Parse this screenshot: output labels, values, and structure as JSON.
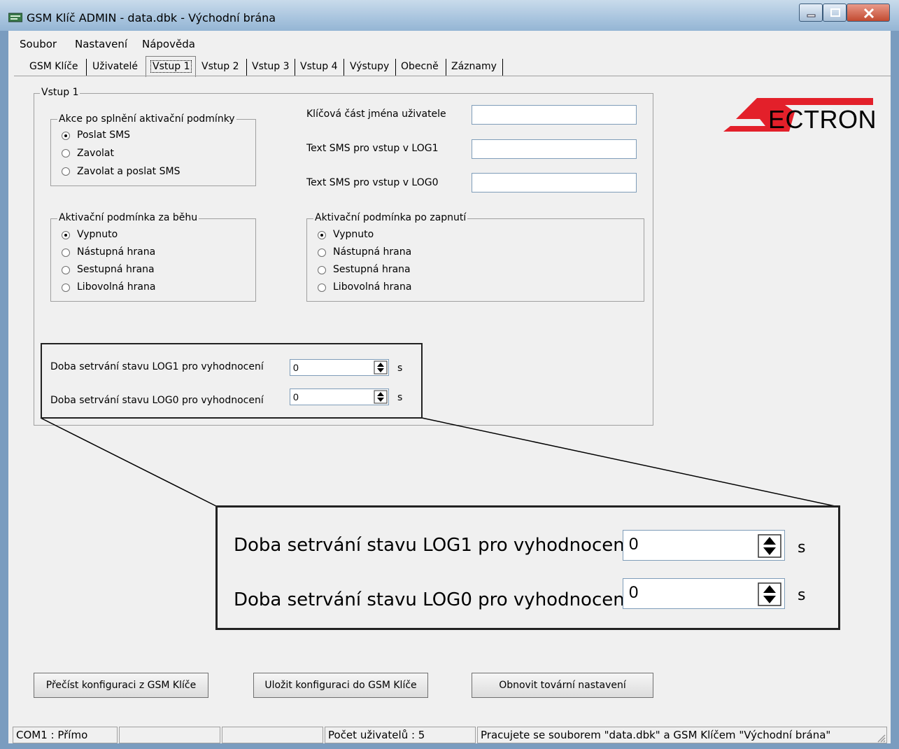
{
  "window": {
    "title": "GSM Klíč ADMIN - data.dbk - Východní brána"
  },
  "menu": {
    "items": [
      {
        "label": "Soubor"
      },
      {
        "label": "Nastavení"
      },
      {
        "label": "Nápověda"
      }
    ]
  },
  "tabs": [
    {
      "label": "GSM Klíče"
    },
    {
      "label": "Uživatelé"
    },
    {
      "label": "Vstup 1",
      "active": true
    },
    {
      "label": "Vstup 2"
    },
    {
      "label": "Vstup 3"
    },
    {
      "label": "Vstup 4"
    },
    {
      "label": "Výstupy"
    },
    {
      "label": "Obecně"
    },
    {
      "label": "Záznamy"
    }
  ],
  "vstup": {
    "group_label": "Vstup 1",
    "logo_text": "ECTRON",
    "logo_full": "SECTRON",
    "action_group": {
      "label": "Akce po splnění aktivační podmínky",
      "options": [
        "Poslat SMS",
        "Zavolat",
        "Zavolat a poslat SMS"
      ],
      "selected": "Poslat SMS"
    },
    "fields": {
      "key_name_label": "Klíčová část  jména uživatele",
      "key_name_value": "",
      "sms_log1_label": "Text SMS pro vstup v LOG1",
      "sms_log1_value": "",
      "sms_log0_label": "Text SMS pro vstup v LOG0",
      "sms_log0_value": ""
    },
    "runtime_group": {
      "label": "Aktivační podmínka za běhu",
      "options": [
        "Vypnuto",
        "Nástupná hrana",
        "Sestupná hrana",
        "Libovolná hrana"
      ],
      "selected": "Vypnuto"
    },
    "poweron_group": {
      "label": "Aktivační podmínka po zapnutí",
      "options": [
        "Vypnuto",
        "Nástupná hrana",
        "Sestupná hrana",
        "Libovolná hrana"
      ],
      "selected": "Vypnuto"
    },
    "hold": {
      "log1_label": "Doba setrvání stavu LOG1 pro vyhodnocení",
      "log1_value": "0",
      "log0_label": "Doba setrvání stavu LOG0 pro vyhodnocení",
      "log0_value": "0",
      "unit": "s"
    }
  },
  "buttons": {
    "read": "Přečíst konfiguraci z GSM Klíče",
    "save": "Uložit konfiguraci do GSM Klíče",
    "reset": "Obnovit tovární nastavení"
  },
  "status": {
    "port": "COM1 : Přímo",
    "cell2": "",
    "cell3": "",
    "users": "Počet uživatelů : 5",
    "message": "Pracujete se souborem \"data.dbk\" a GSM Klíčem \"Východní brána\""
  },
  "colors": {
    "logo_red": "#e3202a",
    "window_chrome": "#a8c4de",
    "close_button": "#c24a30"
  }
}
